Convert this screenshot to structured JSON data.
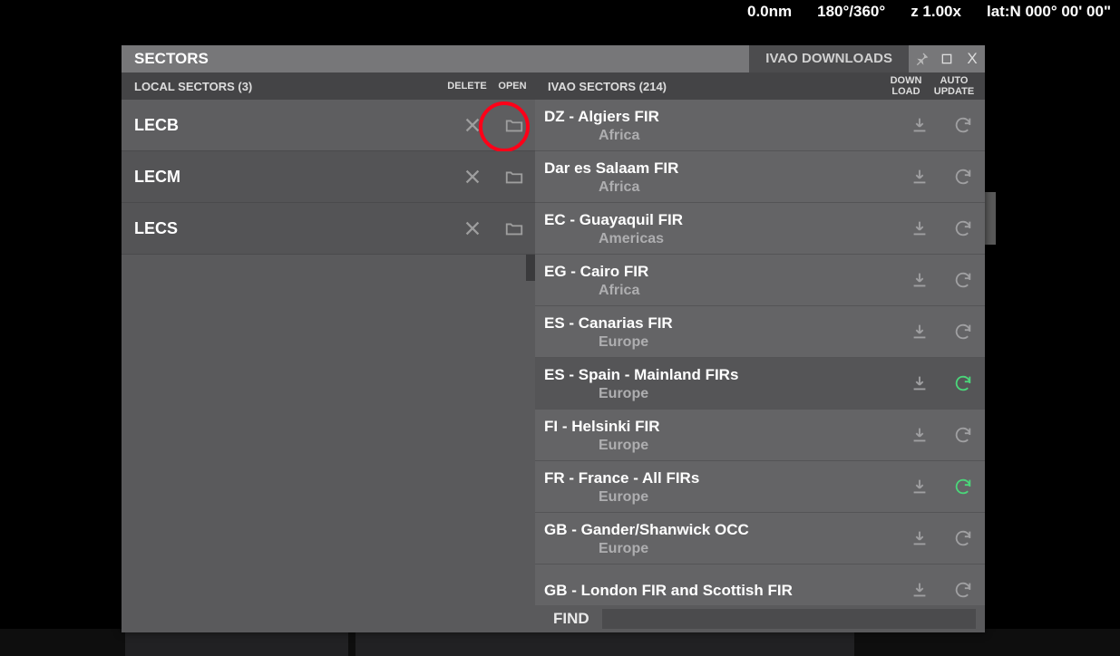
{
  "status": {
    "distance": "0.0nm",
    "heading": "180°/360°",
    "zoom": "z 1.00x",
    "latlon": "lat:N 000° 00' 00\""
  },
  "dialog": {
    "title": "SECTORS",
    "tab_ivao": "IVAO DOWNLOADS"
  },
  "local": {
    "header": "LOCAL SECTORS (3)",
    "col_delete": "DELETE",
    "col_open": "OPEN",
    "items": [
      {
        "name": "LECB",
        "highlighted": true
      },
      {
        "name": "LECM",
        "highlighted": false
      },
      {
        "name": "LECS",
        "highlighted": false
      }
    ]
  },
  "ivao": {
    "header": "IVAO SECTORS (214)",
    "col_download_1": "DOWN",
    "col_download_2": "LOAD",
    "col_update_1": "AUTO",
    "col_update_2": "UPDATE",
    "items": [
      {
        "fir": "DZ - Algiers FIR",
        "region": "Africa",
        "green": false
      },
      {
        "fir": "Dar es Salaam FIR",
        "region": "Africa",
        "green": false
      },
      {
        "fir": "EC - Guayaquil FIR",
        "region": "Americas",
        "green": false
      },
      {
        "fir": "EG - Cairo FIR",
        "region": "Africa",
        "green": false
      },
      {
        "fir": "ES - Canarias FIR",
        "region": "Europe",
        "green": false
      },
      {
        "fir": "ES - Spain - Mainland FIRs",
        "region": "Europe",
        "green": true,
        "alt": true
      },
      {
        "fir": "FI - Helsinki FIR",
        "region": "Europe",
        "green": false
      },
      {
        "fir": "FR - France - All FIRs",
        "region": "Europe",
        "green": true
      },
      {
        "fir": "GB - Gander/Shanwick OCC",
        "region": "Europe",
        "green": false
      },
      {
        "fir": "GB - London FIR and Scottish FIR",
        "region": "",
        "green": false
      }
    ]
  },
  "find": {
    "label": "FIND",
    "value": ""
  }
}
